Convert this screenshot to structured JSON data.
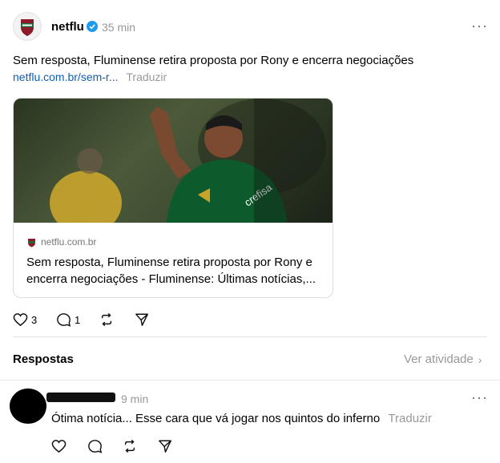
{
  "post": {
    "username": "netflu",
    "verified_icon": "verified-badge-icon",
    "time": "35 min",
    "text": "Sem resposta, Fluminense retira proposta por Rony e encerra negociações",
    "link": "netflu.com.br/sem-r...",
    "translate": "Traduzir",
    "card": {
      "domain": "netflu.com.br",
      "title_line1": "Sem resposta, Fluminense retira proposta por Rony e",
      "title_line2": "encerra negociações - Fluminense: Últimas notícias,..."
    },
    "actions": {
      "likes": "3",
      "replies": "1"
    }
  },
  "replies_header": {
    "title": "Respostas",
    "view_activity": "Ver atividade"
  },
  "reply": {
    "time": "9 min",
    "text": "Ótima notícia... Esse cara que vá jogar nos quintos do inferno",
    "translate": "Traduzir"
  },
  "colors": {
    "accent_link": "#0f5fb5",
    "muted": "#999999",
    "verified": "#1d9bf0"
  }
}
